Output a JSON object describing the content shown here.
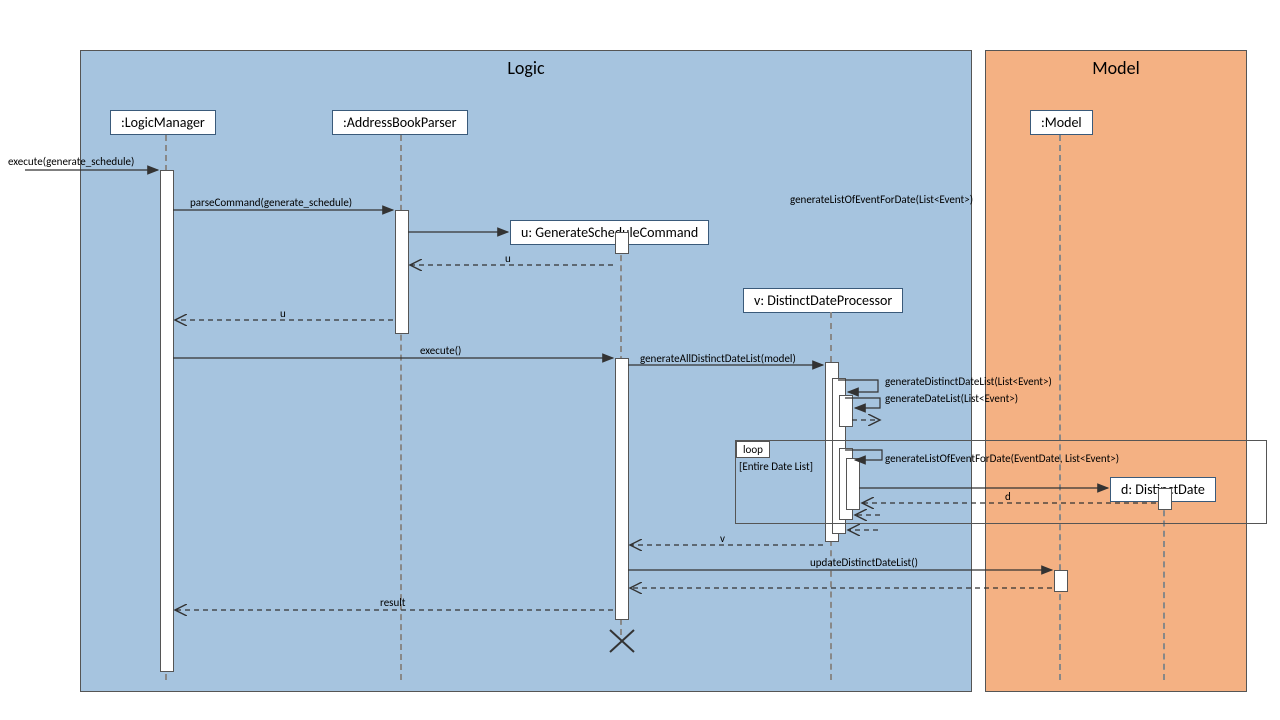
{
  "frames": {
    "logic": {
      "title": "Logic"
    },
    "model": {
      "title": "Model"
    }
  },
  "lifelines": {
    "logicManager": ":LogicManager",
    "addressBookParser": ":AddressBookParser",
    "generateScheduleCmd": "u: GenerateScheduleCommand",
    "distinctDateProcessor": "v: DistinctDateProcessor",
    "model": ":Model",
    "distinctDate": "d: DistinctDate"
  },
  "messages": {
    "executeEntry": "execute(generate_schedule)",
    "parseCommand": "parseCommand(generate_schedule)",
    "returnU1": "u",
    "returnU2": "u",
    "executeCall": "execute()",
    "genAllDistinct": "generateAllDistinctDateList(model)",
    "genDistinctDateList": "generateDistinctDateList(List<Event>)",
    "genDateList": "generateDateList(List<Event>)",
    "genListEventForDateTop": "generateListOfEventForDate(List<Event>)",
    "genListEventForDateLoop": "generateListOfEventForDate(EventDate, List<Event>)",
    "returnD": "d",
    "returnV": "v",
    "updateDistinct": "updateDistinctDateList()",
    "result": "result"
  },
  "loop": {
    "label": "loop",
    "guard": "[Entire Date List]"
  },
  "chart_data": {
    "type": "sequence_diagram",
    "frames": [
      {
        "name": "Logic",
        "children": [
          "LogicManager",
          "AddressBookParser",
          "GenerateScheduleCommand",
          "DistinctDateProcessor"
        ]
      },
      {
        "name": "Model",
        "children": [
          "Model",
          "DistinctDate"
        ]
      }
    ],
    "lifelines": [
      "LogicManager",
      "AddressBookParser",
      "GenerateScheduleCommand",
      "DistinctDateProcessor",
      "Model",
      "DistinctDate"
    ],
    "messages": [
      {
        "from": "caller",
        "to": "LogicManager",
        "label": "execute(generate_schedule)",
        "type": "sync"
      },
      {
        "from": "LogicManager",
        "to": "AddressBookParser",
        "label": "parseCommand(generate_schedule)",
        "type": "sync"
      },
      {
        "from": "AddressBookParser",
        "to": "GenerateScheduleCommand",
        "label": "create",
        "type": "sync"
      },
      {
        "from": "GenerateScheduleCommand",
        "to": "AddressBookParser",
        "label": "u",
        "type": "return"
      },
      {
        "from": "AddressBookParser",
        "to": "LogicManager",
        "label": "u",
        "type": "return"
      },
      {
        "from": "LogicManager",
        "to": "GenerateScheduleCommand",
        "label": "execute()",
        "type": "sync"
      },
      {
        "from": "GenerateScheduleCommand",
        "to": "DistinctDateProcessor",
        "label": "generateAllDistinctDateList(model)",
        "type": "sync"
      },
      {
        "from": "DistinctDateProcessor",
        "to": "DistinctDateProcessor",
        "label": "generateDistinctDateList(List<Event>)",
        "type": "self"
      },
      {
        "from": "DistinctDateProcessor",
        "to": "DistinctDateProcessor",
        "label": "generateDateList(List<Event>)",
        "type": "self"
      },
      {
        "from": "DistinctDateProcessor",
        "to": "DistinctDateProcessor",
        "label": "generateListOfEventForDate(List<Event>)",
        "type": "self"
      },
      {
        "from": "DistinctDateProcessor",
        "to": "DistinctDateProcessor",
        "label": "generateListOfEventForDate(EventDate, List<Event>)",
        "type": "self",
        "fragment": "loop"
      },
      {
        "from": "DistinctDateProcessor",
        "to": "DistinctDate",
        "label": "create",
        "type": "sync",
        "fragment": "loop"
      },
      {
        "from": "DistinctDate",
        "to": "DistinctDateProcessor",
        "label": "d",
        "type": "return",
        "fragment": "loop"
      },
      {
        "from": "DistinctDateProcessor",
        "to": "GenerateScheduleCommand",
        "label": "v",
        "type": "return"
      },
      {
        "from": "GenerateScheduleCommand",
        "to": "Model",
        "label": "updateDistinctDateList()",
        "type": "sync"
      },
      {
        "from": "Model",
        "to": "GenerateScheduleCommand",
        "label": "",
        "type": "return"
      },
      {
        "from": "GenerateScheduleCommand",
        "to": "LogicManager",
        "label": "result",
        "type": "return"
      },
      {
        "from": "GenerateScheduleCommand",
        "to": null,
        "label": "destroy",
        "type": "destroy"
      }
    ],
    "fragments": [
      {
        "type": "loop",
        "guard": "[Entire Date List]",
        "over": [
          "DistinctDateProcessor",
          "DistinctDate"
        ]
      }
    ]
  }
}
